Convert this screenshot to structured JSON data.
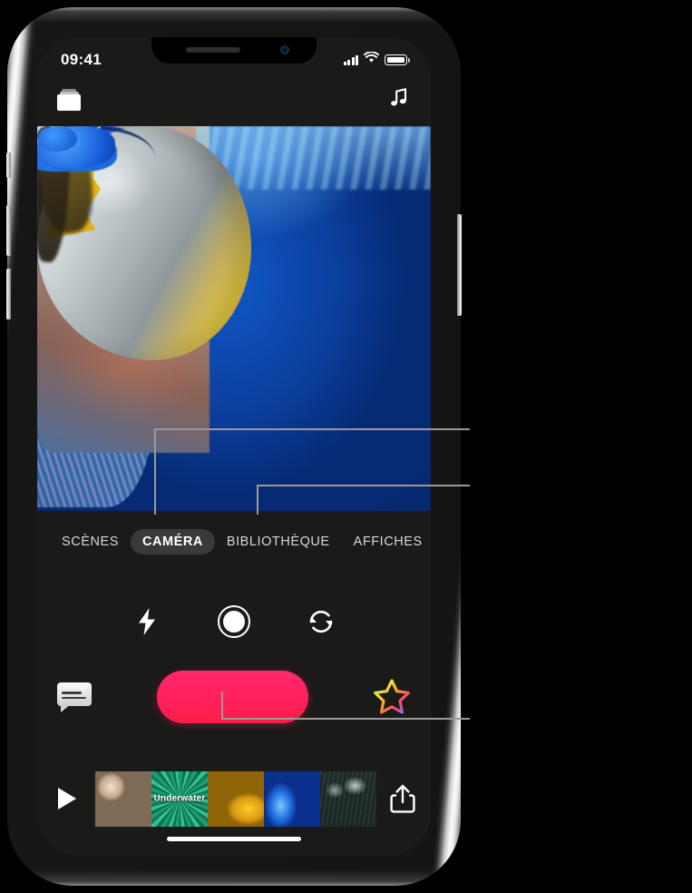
{
  "status_bar": {
    "time": "09:41",
    "icons": [
      "cellular-signal-icon",
      "wifi-icon",
      "battery-icon"
    ],
    "signal_bars": 4,
    "battery_full": true
  },
  "app_topbar": {
    "projects_icon": "projects-stack-icon",
    "music_icon": "music-note-icon",
    "music_glyph": "♫"
  },
  "video_preview": {
    "scene_description": "underwater aquarium scene with a batfish, blue tang fish and coral reef",
    "background_color": "#0a3fa8"
  },
  "tab_bar": {
    "tabs": [
      {
        "label": "SCÈNES",
        "selected": false
      },
      {
        "label": "CAMÉRA",
        "selected": true
      },
      {
        "label": "BIBLIOTHÈQUE",
        "selected": false
      },
      {
        "label": "AFFICHES",
        "selected": false
      }
    ]
  },
  "camera_controls": {
    "buttons": [
      {
        "name": "flash-icon",
        "glyph": "⚡"
      },
      {
        "name": "capture-mode-icon",
        "glyph": "●"
      },
      {
        "name": "flip-camera-icon",
        "glyph": "↻"
      }
    ]
  },
  "record_row": {
    "teleprompter_icon": "teleprompter-bubble-icon",
    "record_button": "record-button",
    "record_color_start": "#FF2A6E",
    "record_color_end": "#FF1C47",
    "effects_icon": "rainbow-star-effects-icon"
  },
  "filmstrip": {
    "play_icon": "play-icon",
    "share_icon": "share-icon",
    "clips": [
      {
        "name": "clip-thumbnail-1",
        "caption": ""
      },
      {
        "name": "clip-thumbnail-2",
        "caption": "Underwater"
      },
      {
        "name": "clip-thumbnail-3",
        "caption": ""
      },
      {
        "name": "clip-thumbnail-4",
        "caption": ""
      },
      {
        "name": "clip-thumbnail-5",
        "caption": ""
      }
    ]
  },
  "home_indicator": "home-indicator",
  "callouts": [
    {
      "name": "callout-camera-tab",
      "target": "CAMÉRA"
    },
    {
      "name": "callout-library-tab",
      "target": "BIBLIOTHÈQUE"
    },
    {
      "name": "callout-record-button",
      "target": "record-button"
    }
  ]
}
